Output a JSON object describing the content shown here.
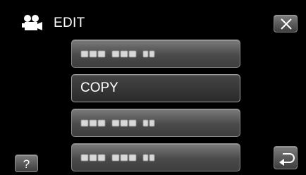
{
  "header": {
    "title": "EDIT",
    "mode_icon": "movie-camera-icon",
    "close_icon": "close-icon"
  },
  "menu": {
    "items": [
      {
        "label": "",
        "state": "obscured"
      },
      {
        "label": "COPY",
        "state": "selected"
      },
      {
        "label": "",
        "state": "obscured"
      },
      {
        "label": "",
        "state": "obscured"
      }
    ]
  },
  "footer": {
    "help_label": "?",
    "back_icon": "return-icon"
  },
  "colors": {
    "background": "#000000",
    "button_top": "#7c7c7c",
    "button_bottom": "#3d3d3d",
    "border": "#8c8c8c",
    "text": "#ffffff"
  }
}
